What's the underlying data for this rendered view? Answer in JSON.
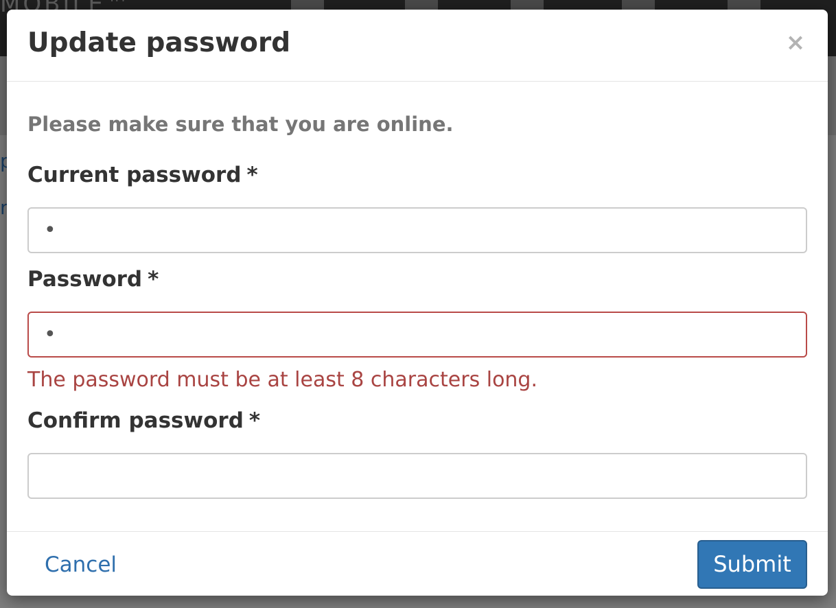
{
  "background": {
    "logo_text": "MOBILE™",
    "nav_icons": [
      "mail-icon",
      "flag-icon",
      "list-icon",
      "user-icon",
      "chart-icon"
    ],
    "snippets": [
      "p",
      "n"
    ]
  },
  "modal": {
    "title": "Update password",
    "close_glyph": "×",
    "notice": "Please make sure that you are online.",
    "fields": {
      "current": {
        "label": "Current password",
        "required_mark": "*",
        "value": "•"
      },
      "password": {
        "label": "Password",
        "required_mark": "*",
        "value": "•",
        "error": "The password must be at least 8 characters long."
      },
      "confirm": {
        "label": "Confirm password",
        "required_mark": "*",
        "value": ""
      }
    },
    "footer": {
      "cancel_label": "Cancel",
      "submit_label": "Submit"
    }
  },
  "colors": {
    "primary": "#3177b5",
    "error": "#a94442",
    "link": "#2f6fad"
  }
}
